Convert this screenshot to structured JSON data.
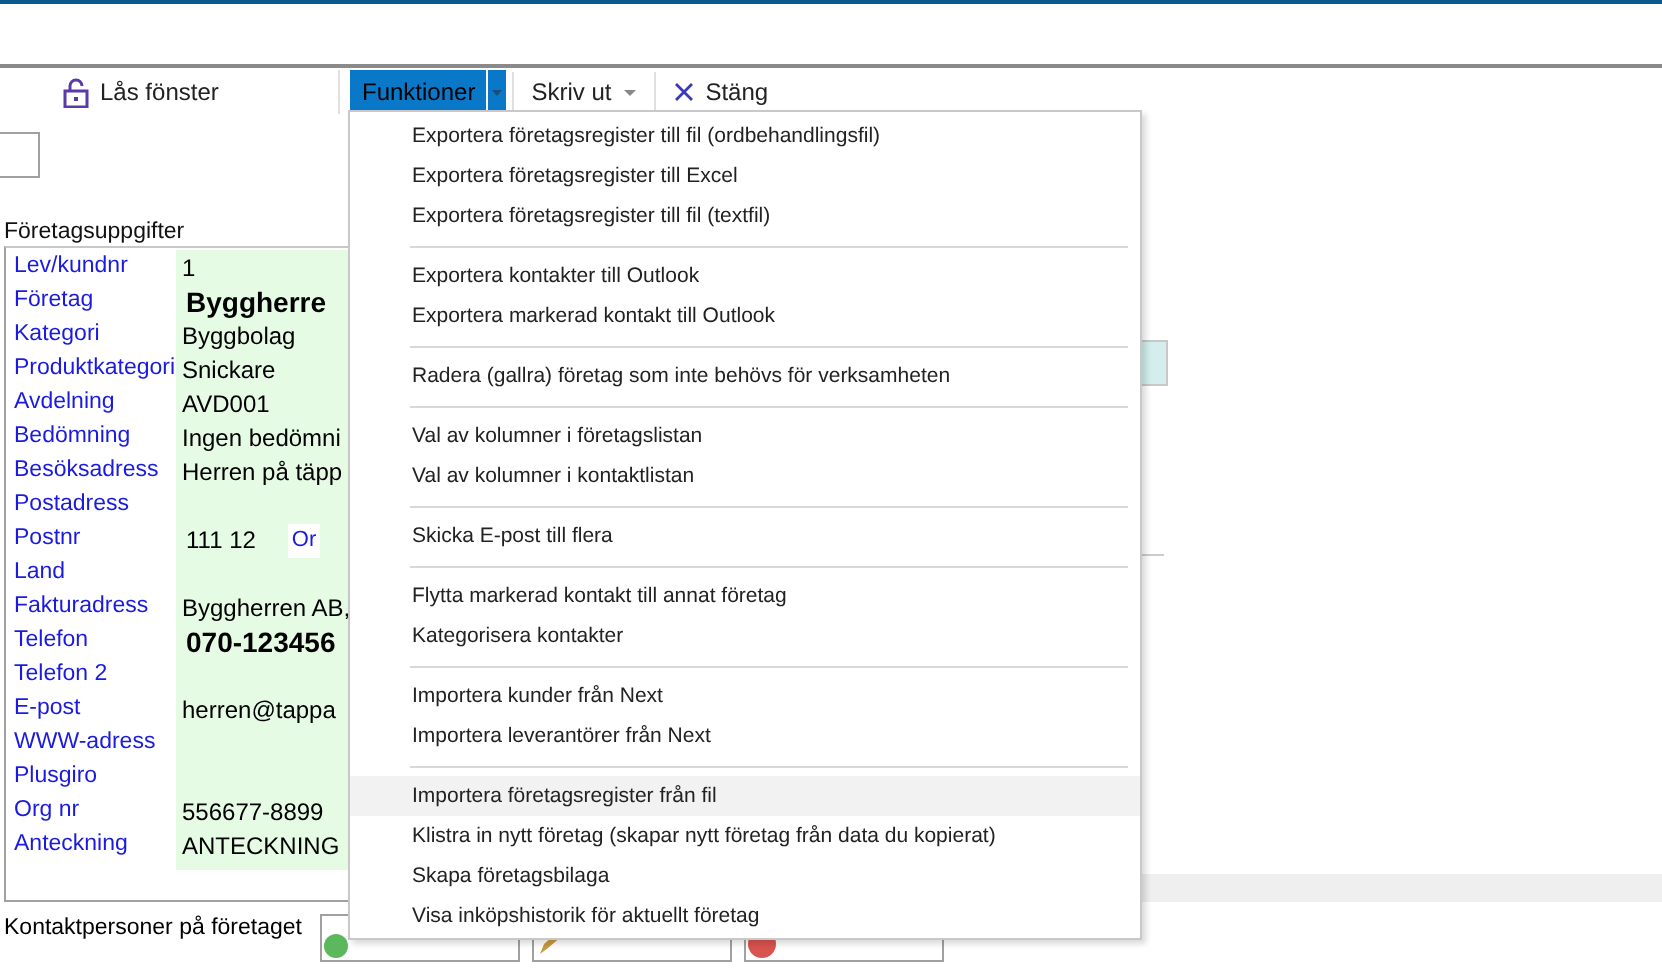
{
  "toolbar": {
    "lock": "Lås fönster",
    "buttons": [
      {
        "kind": "split",
        "label": "Funktioner",
        "selected": true
      },
      {
        "kind": "dropdown",
        "label": "Skriv ut",
        "selected": false
      },
      {
        "kind": "close",
        "label": "Stäng",
        "selected": false
      }
    ]
  },
  "section_title": "Företagsuppgifter",
  "fields": [
    {
      "label": "Lev/kundnr",
      "value": "1",
      "kind": "plain"
    },
    {
      "label": "Företag",
      "value": "Byggherre",
      "kind": "bold"
    },
    {
      "label": "Kategori",
      "value": "Byggbolag",
      "kind": "plain"
    },
    {
      "label": "Produktkategori",
      "value": "Snickare",
      "kind": "plain"
    },
    {
      "label": "Avdelning",
      "value": "AVD001",
      "kind": "plain"
    },
    {
      "label": "Bedömning",
      "value": "Ingen bedömni",
      "kind": "plain"
    },
    {
      "label": "Besöksadress",
      "value": "Herren på täpp",
      "kind": "plain"
    },
    {
      "label": "Postadress",
      "kind": "plain"
    },
    {
      "label": "Postnr",
      "value": "111 12",
      "kind": "postnr",
      "extra": "Or"
    },
    {
      "label": "Land",
      "kind": "plain"
    },
    {
      "label": "Fakturadress",
      "value": "Byggherren AB,",
      "kind": "plain"
    },
    {
      "label": "Telefon",
      "value": "070-123456",
      "kind": "bold"
    },
    {
      "label": "Telefon 2",
      "kind": "plain"
    },
    {
      "label": "E-post",
      "value": "herren@tappa",
      "kind": "plain"
    },
    {
      "label": "WWW-adress",
      "kind": "plain"
    },
    {
      "label": "Plusgiro",
      "kind": "plain"
    },
    {
      "label": "Org nr",
      "value": "556677-8899",
      "kind": "plain"
    },
    {
      "label": "Anteckning",
      "value": "ANTECKNING",
      "kind": "plain"
    }
  ],
  "contacts_label": "Kontaktpersoner på företaget",
  "contact_buttons": [
    {
      "kind": "add"
    },
    {
      "kind": "edit"
    },
    {
      "kind": "delete"
    }
  ],
  "menu": [
    {
      "kind": "item",
      "label": "Exportera företagsregister till fil (ordbehandlingsfil)",
      "highlighted": false
    },
    {
      "kind": "item",
      "label": "Exportera företagsregister till Excel",
      "highlighted": false
    },
    {
      "kind": "item",
      "label": "Exportera företagsregister till fil (textfil)",
      "highlighted": false
    },
    {
      "kind": "separator"
    },
    {
      "kind": "item",
      "label": "Exportera kontakter till Outlook",
      "highlighted": false
    },
    {
      "kind": "item",
      "label": "Exportera markerad kontakt till Outlook",
      "highlighted": false
    },
    {
      "kind": "separator"
    },
    {
      "kind": "item",
      "label": "Radera (gallra) företag som inte behövs för verksamheten",
      "highlighted": false
    },
    {
      "kind": "separator"
    },
    {
      "kind": "item",
      "label": "Val av kolumner i företagslistan",
      "highlighted": false
    },
    {
      "kind": "item",
      "label": "Val av kolumner i kontaktlistan",
      "highlighted": false
    },
    {
      "kind": "separator"
    },
    {
      "kind": "item",
      "label": "Skicka E-post till flera",
      "highlighted": false
    },
    {
      "kind": "separator"
    },
    {
      "kind": "item",
      "label": "Flytta markerad kontakt till annat företag",
      "highlighted": false
    },
    {
      "kind": "item",
      "label": "Kategorisera kontakter",
      "highlighted": false
    },
    {
      "kind": "separator"
    },
    {
      "kind": "item",
      "label": "Importera kunder från Next",
      "highlighted": false
    },
    {
      "kind": "item",
      "label": "Importera leverantörer från Next",
      "highlighted": false
    },
    {
      "kind": "separator"
    },
    {
      "kind": "item",
      "label": "Importera företagsregister från fil",
      "highlighted": true
    },
    {
      "kind": "item",
      "label": "Klistra in nytt företag  (skapar nytt företag från data du kopierat)",
      "highlighted": false
    },
    {
      "kind": "item",
      "label": "Skapa företagsbilaga",
      "highlighted": false
    },
    {
      "kind": "item",
      "label": "Visa inköpshistorik för aktuellt företag",
      "highlighted": false
    }
  ]
}
